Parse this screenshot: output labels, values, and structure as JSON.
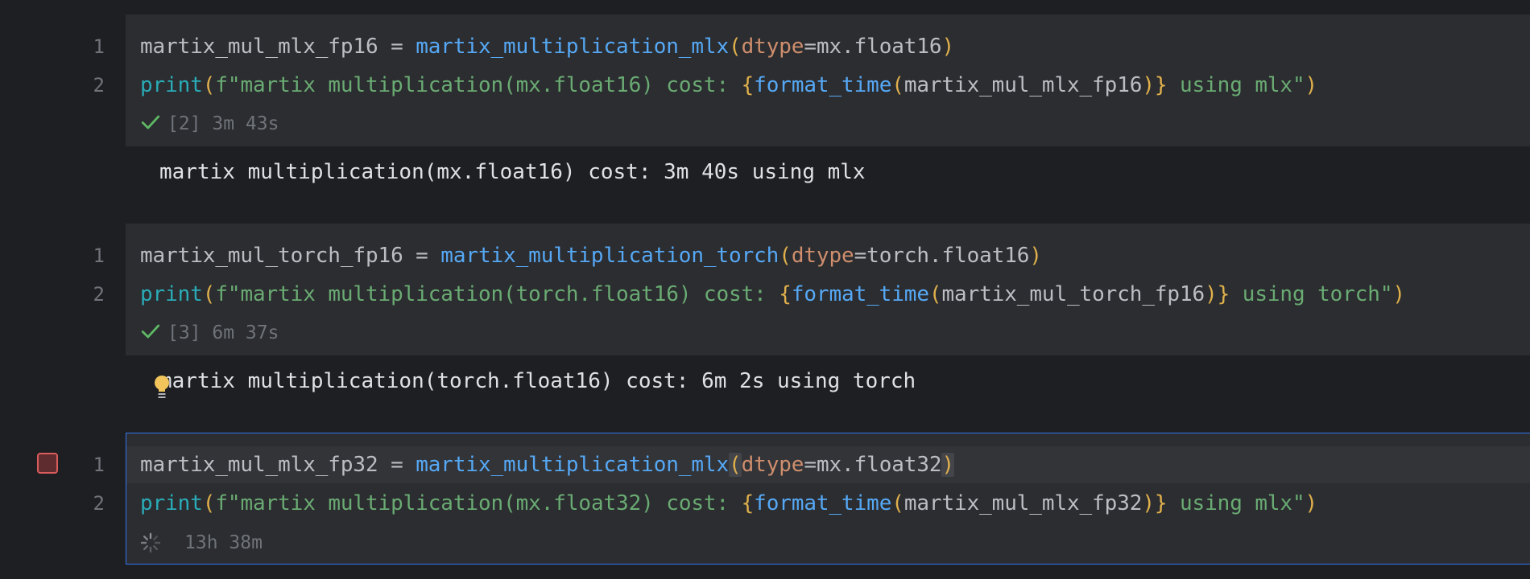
{
  "cells": [
    {
      "line_numbers": [
        "1",
        "2"
      ],
      "line1": {
        "var": "martix_mul_mlx_fp16",
        "eq": " = ",
        "fn": "martix_multiplication_mlx",
        "open": "(",
        "param": "dtype",
        "assign": "=",
        "arg": "mx.float16",
        "close": ")"
      },
      "line2": {
        "builtin": "print",
        "open": "(",
        "str_start": "f\"martix multiplication(mx.float16) cost: ",
        "brace_open": "{",
        "fn": "format_time",
        "paren_open": "(",
        "arg": "martix_mul_mlx_fp16",
        "paren_close": ")",
        "brace_close": "}",
        "str_end": " using mlx\"",
        "close": ")"
      },
      "status": "[2] 3m 43s",
      "output": "martix multiplication(mx.float16) cost: 3m 40s using mlx"
    },
    {
      "line_numbers": [
        "1",
        "2"
      ],
      "line1": {
        "var": "martix_mul_torch_fp16",
        "eq": " = ",
        "fn": "martix_multiplication_torch",
        "open": "(",
        "param": "dtype",
        "assign": "=",
        "arg": "torch.float16",
        "close": ")"
      },
      "line2": {
        "builtin": "print",
        "open": "(",
        "str_start": "f\"martix multiplication(torch.float16) cost: ",
        "brace_open": "{",
        "fn": "format_time",
        "paren_open": "(",
        "arg": "martix_mul_torch_fp16",
        "paren_close": ")",
        "brace_close": "}",
        "str_end": " using torch\"",
        "close": ")"
      },
      "status": "[3] 6m 37s",
      "output": "martix multiplication(torch.float16) cost: 6m 2s using torch"
    },
    {
      "line_numbers": [
        "1",
        "2"
      ],
      "line1": {
        "var": "martix_mul_mlx_fp32",
        "eq": " = ",
        "fn": "martix_multiplication_mlx",
        "open": "(",
        "param": "dtype",
        "assign": "=",
        "arg": "mx.float32",
        "close": ")"
      },
      "line2": {
        "builtin": "print",
        "open": "(",
        "str_start": "f\"martix multiplication(mx.float32) cost: ",
        "brace_open": "{",
        "fn": "format_time",
        "paren_open": "(",
        "arg": "martix_mul_mlx_fp32",
        "paren_close": ")",
        "brace_close": "}",
        "str_end": " using mlx\"",
        "close": ")"
      },
      "status": "13h 38m"
    }
  ],
  "icons": {
    "success": "check-icon",
    "running": "spinner-icon",
    "stop": "stop-icon",
    "hint": "lightbulb-icon"
  },
  "colors": {
    "background": "#1e1f22",
    "cell_bg": "#2b2d30",
    "active_border": "#3574f0",
    "function": "#56a8f5",
    "parameter": "#cf8e6d",
    "string": "#6aab73",
    "builtin": "#2aacb8",
    "brace": "#e0b04c",
    "success": "#5fb865",
    "stop": "#db5c5c"
  }
}
